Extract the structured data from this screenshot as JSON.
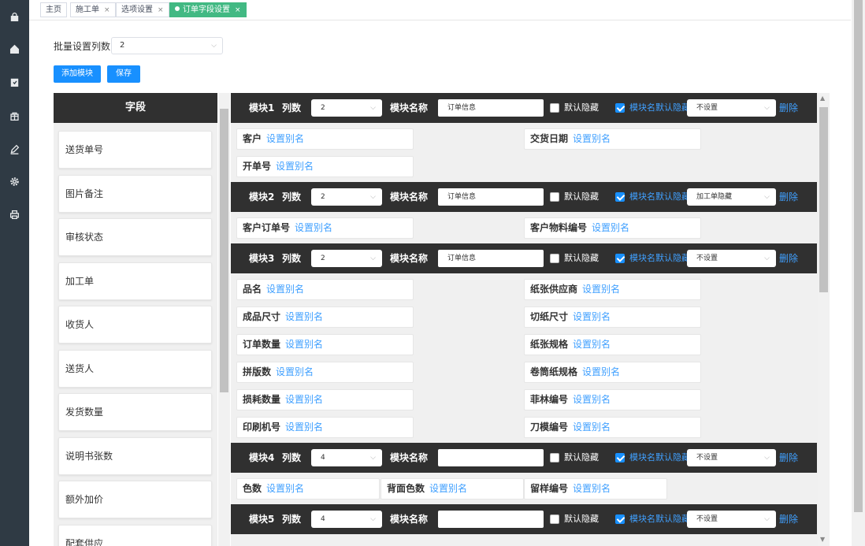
{
  "tabs": [
    {
      "label": "主页",
      "closable": false
    },
    {
      "label": "施工单",
      "closable": true
    },
    {
      "label": "选项设置",
      "closable": true
    },
    {
      "label": "订单字段设置",
      "closable": true,
      "active": true
    }
  ],
  "sidebar_icons": [
    "lock-icon",
    "home-icon",
    "clipboard-icon",
    "box-icon",
    "pen-icon",
    "gear-icon",
    "printer-icon"
  ],
  "toolbar": {
    "batch_label": "批量设置列数",
    "batch_value": "2",
    "add_module_label": "添加模块",
    "save_label": "保存"
  },
  "fields_header": "字段",
  "fields": [
    "送货单号",
    "图片备注",
    "审核状态",
    "加工单",
    "收货人",
    "送货人",
    "发货数量",
    "说明书张数",
    "额外加价",
    "配套供应"
  ],
  "module_labels": {
    "columns": "列数",
    "name": "模块名称",
    "default_hidden": "默认隐藏",
    "name_default_hidden": "模块名默认隐藏",
    "delete": "删除",
    "alias": "设置别名"
  },
  "modules": [
    {
      "title": "模块1",
      "columns": "2",
      "name": "订单信息",
      "hidden": false,
      "name_hidden": true,
      "mode": "不设置",
      "fields": [
        [
          "客户",
          "交货日期"
        ],
        [
          "开单号"
        ]
      ]
    },
    {
      "title": "模块2",
      "columns": "2",
      "name": "订单信息",
      "hidden": false,
      "name_hidden": true,
      "mode": "加工单隐藏",
      "fields": [
        [
          "客户订单号",
          "客户物料编号"
        ]
      ]
    },
    {
      "title": "模块3",
      "columns": "2",
      "name": "订单信息",
      "hidden": false,
      "name_hidden": true,
      "mode": "不设置",
      "fields": [
        [
          "品名",
          "纸张供应商"
        ],
        [
          "成品尺寸",
          "切纸尺寸"
        ],
        [
          "订单数量",
          "纸张规格"
        ],
        [
          "拼版数",
          "卷筒纸规格"
        ],
        [
          "损耗数量",
          "菲林编号"
        ],
        [
          "印刷机号",
          "刀模编号"
        ]
      ]
    },
    {
      "title": "模块4",
      "columns": "4",
      "name": "",
      "hidden": false,
      "name_hidden": true,
      "mode": "不设置",
      "fields": [
        [
          "色数",
          "背面色数",
          "留样编号"
        ]
      ]
    },
    {
      "title": "模块5",
      "columns": "4",
      "name": "",
      "hidden": false,
      "name_hidden": true,
      "mode": "不设置",
      "fields": []
    }
  ]
}
